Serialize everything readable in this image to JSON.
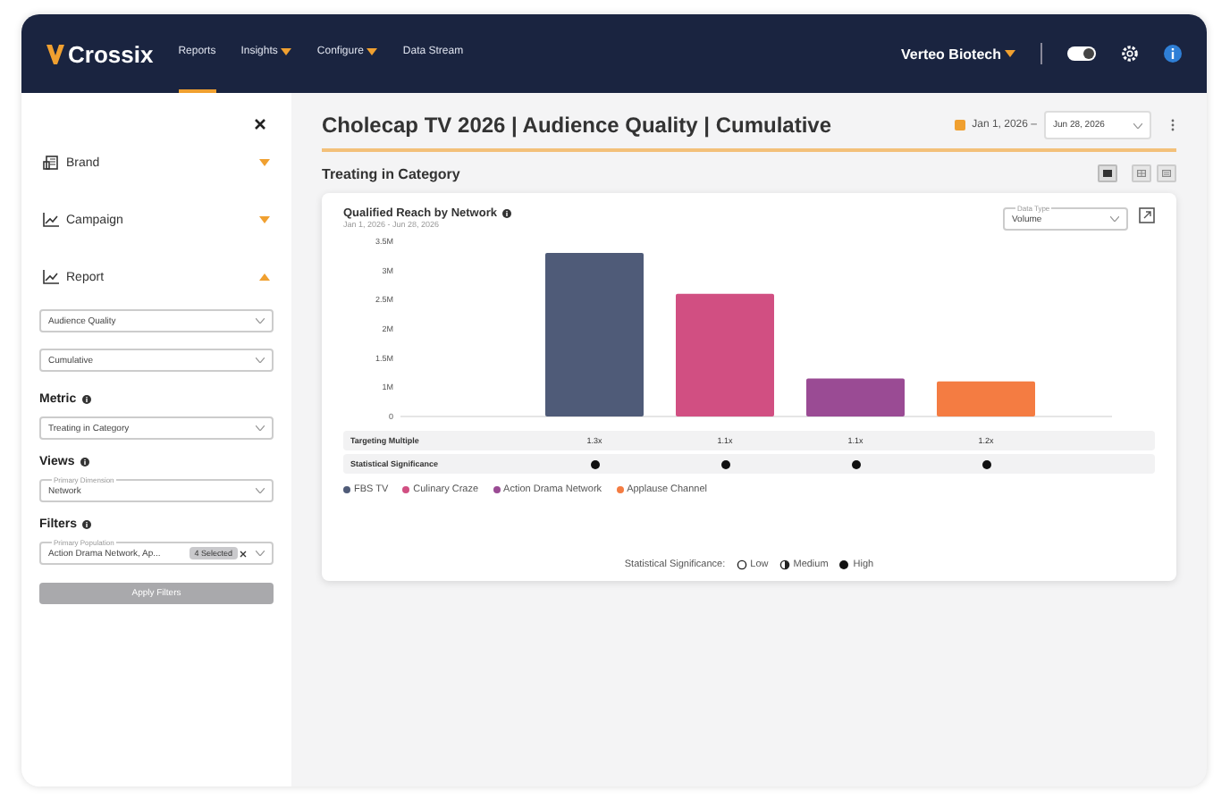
{
  "header": {
    "logo": "Crossix",
    "nav": [
      {
        "label": "Reports",
        "selected": true,
        "dropdown": false
      },
      {
        "label": "Insights",
        "selected": false,
        "dropdown": true
      },
      {
        "label": "Configure",
        "selected": false,
        "dropdown": true
      },
      {
        "label": "Data Stream",
        "selected": false,
        "dropdown": false
      }
    ],
    "account": "Verteo Biotech",
    "toggle": {
      "on": true
    }
  },
  "sidebar": {
    "sections": [
      {
        "label": "Brand",
        "kind": "brand",
        "expanded": false
      },
      {
        "label": "Campaign",
        "kind": "chart",
        "expanded": false
      },
      {
        "label": "Report",
        "kind": "chart",
        "expanded": true
      }
    ],
    "report_selects": [
      "Audience Quality",
      "Cumulative"
    ],
    "metric": {
      "label": "Metric",
      "value": "Treating in Category"
    },
    "views": {
      "label": "Views",
      "floating_label": "Primary Dimension",
      "value": "Network"
    },
    "filters": {
      "label": "Filters",
      "floating_label": "Primary Population",
      "value": "Action Drama Network, Ap...",
      "chip": "4 Selected"
    },
    "apply_button": {
      "label": "Apply Filters",
      "disabled": true
    }
  },
  "main": {
    "title": "Cholecap TV 2026 | Audience Quality | Cumulative",
    "date_from": "Jan 1, 2026 –",
    "date_to": "Jun 28, 2026",
    "section": "Treating in Category",
    "view_buttons": [
      {
        "kind": "chart",
        "selected": true
      },
      {
        "kind": "table",
        "selected": false
      },
      {
        "kind": "list",
        "selected": false
      }
    ],
    "card": {
      "title": "Qualified Reach by Network",
      "subtitle": "Jan 1, 2026 - Jun 28, 2026",
      "data_type": {
        "floating_label": "Data Type",
        "value": "Volume"
      },
      "chart_data": {
        "type": "bar",
        "series": [
          {
            "name": "FBS TV",
            "color": "#4f5b78",
            "values": [
              3.3
            ]
          },
          {
            "name": "Culinary Craze",
            "color": "#d14f82",
            "values": [
              2.6
            ]
          },
          {
            "name": "Action Drama Network",
            "color": "#9a4b94",
            "values": [
              1.15
            ]
          },
          {
            "name": "Applause Channel",
            "color": "#f47c42",
            "values": [
              1.1
            ]
          }
        ],
        "ylim": [
          0.5,
          3.5
        ],
        "yticks": [
          {
            "value": 0.5,
            "label": "0"
          },
          {
            "value": 1,
            "label": "1M"
          },
          {
            "value": 1.5,
            "label": "1.5M"
          },
          {
            "value": 2,
            "label": "2M"
          },
          {
            "value": 2.5,
            "label": "2.5M"
          },
          {
            "value": 3,
            "label": "3M"
          },
          {
            "value": 3.5,
            "label": "3.5M"
          }
        ]
      },
      "table": [
        {
          "label": "Targeting Multiple",
          "kind": "text",
          "cells": [
            "1.3x",
            "1.1x",
            "1.1x",
            "1.2x"
          ]
        },
        {
          "label": "Statistical Significance",
          "kind": "significance",
          "cells": [
            {
              "kind": "high"
            },
            {
              "kind": "high"
            },
            {
              "kind": "high"
            },
            {
              "kind": "high"
            }
          ]
        }
      ],
      "significance_key": {
        "label": "Statistical Significance:",
        "levels": [
          {
            "kind": "low",
            "label": "Low"
          },
          {
            "kind": "medium",
            "label": "Medium"
          },
          {
            "kind": "high",
            "label": "High"
          }
        ]
      }
    }
  }
}
